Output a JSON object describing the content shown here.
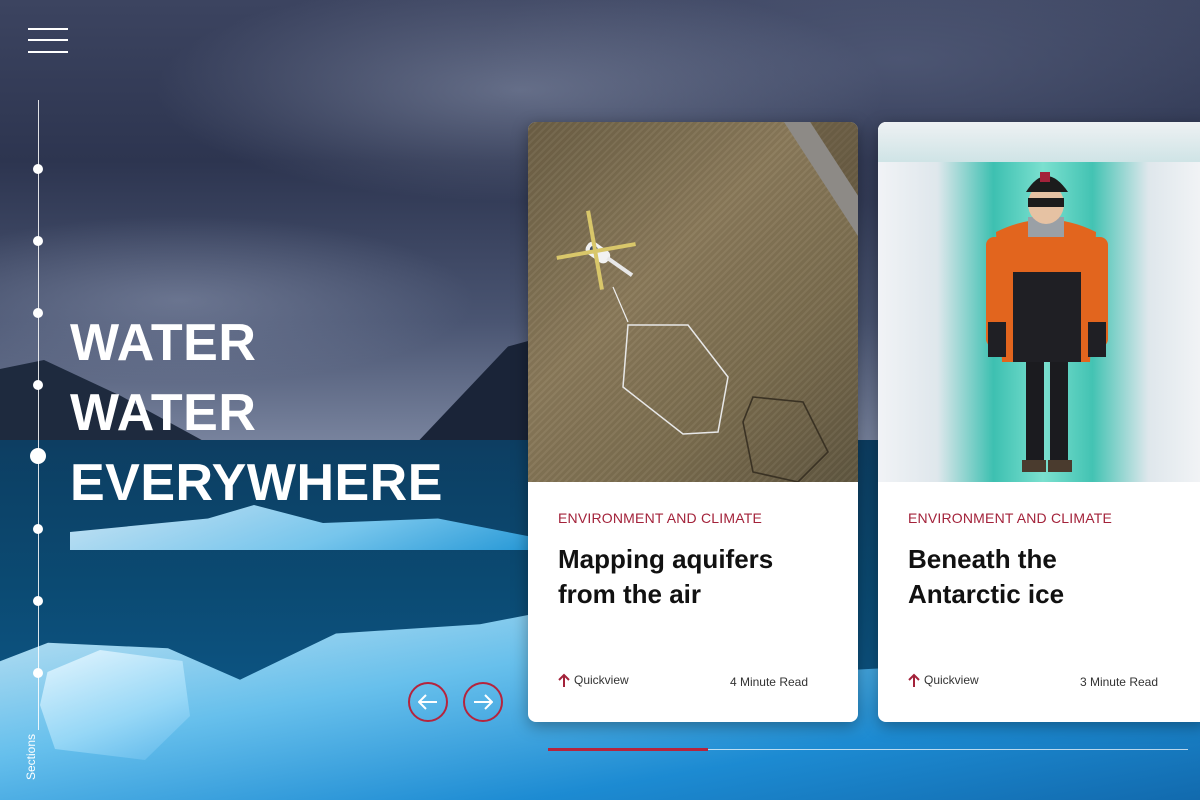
{
  "heading": {
    "line1": "WATER",
    "line2": "WATER",
    "line3": "EVERYWHERE"
  },
  "nav": {
    "menu_icon": "hamburger-menu-icon",
    "sections_label": "Sections",
    "dot_count": 8,
    "active_index": 5
  },
  "carousel": {
    "prev_icon": "arrow-left-icon",
    "next_icon": "arrow-right-icon",
    "accent_color": "#b5243d",
    "progress": 0.25
  },
  "cards": [
    {
      "category": "ENVIRONMENT AND CLIMATE",
      "title": "Mapping aquifers from the air",
      "quickview": "Quickview",
      "read_time": "4 Minute Read",
      "image": "helicopter-over-field"
    },
    {
      "category": "ENVIRONMENT AND CLIMATE",
      "title": "Beneath the Antarctic ice",
      "quickview": "Quickview",
      "read_time": "3 Minute Read",
      "image": "person-in-ice-cave"
    }
  ]
}
